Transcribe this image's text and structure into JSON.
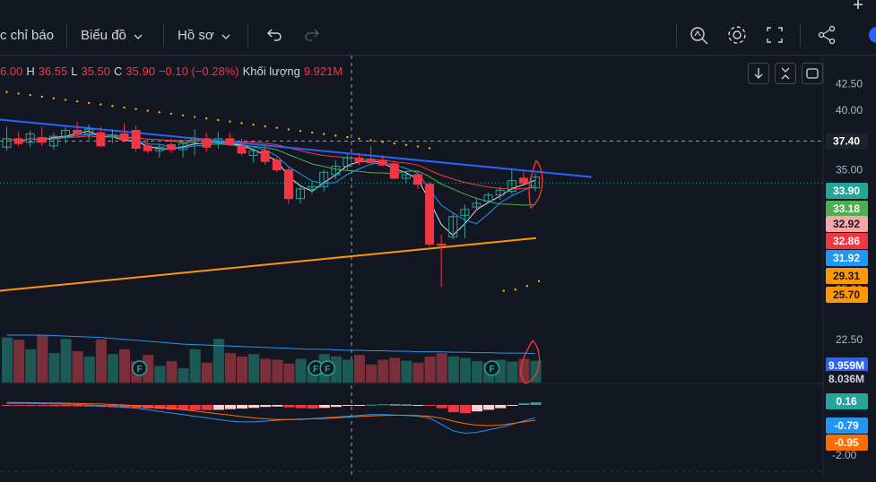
{
  "toolbar": {
    "indicators_label": "c chỉ báo",
    "chart_type_label": "Biểu đồ",
    "profile_label": "Hồ sơ",
    "icons": [
      "undo-icon",
      "redo-icon",
      "search-chart-icon",
      "gear-icon",
      "fullscreen-icon",
      "share-icon"
    ]
  },
  "legend": {
    "open": "6.00",
    "high_label": "H",
    "high": "36.55",
    "low_label": "L",
    "low": "35.50",
    "close_label": "C",
    "close": "35.90",
    "change": "−0.10 (−0.28%)",
    "volume_label": "Khối lượng",
    "volume": "9.921M"
  },
  "chart_data": {
    "type": "candlestick",
    "price_axis": {
      "ticks": [
        "42.50",
        "40.00",
        "35.00",
        "22.50",
        "25.00"
      ],
      "range": [
        21.5,
        43.5
      ]
    },
    "price_tags": [
      {
        "label": "37.40",
        "color": "#1e222d",
        "text_color": "#ffffff"
      },
      {
        "label": "33.90",
        "color": "#26a69a",
        "text_color": "#ffffff"
      },
      {
        "label": "33.18",
        "color": "#4caf50",
        "text_color": "#ffffff"
      },
      {
        "label": "32.92",
        "color": "#f7a6a6",
        "text_color": "#131722"
      },
      {
        "label": "32.86",
        "color": "#f23645",
        "text_color": "#ffffff"
      },
      {
        "label": "31.92",
        "color": "#2196f3",
        "text_color": "#ffffff"
      },
      {
        "label": "29.31",
        "color": "#ff9800",
        "text_color": "#131722"
      },
      {
        "label": "25.70",
        "color": "#ff9800",
        "text_color": "#131722"
      }
    ],
    "volume_tags": [
      {
        "label": "9.959M",
        "color": "#2962ff",
        "text_color": "#ffffff"
      },
      {
        "label": "8.036M",
        "color": "#131722",
        "text_color": "#d1d4dc"
      }
    ],
    "macd_axis": {
      "ticks": [
        "-2.00"
      ]
    },
    "macd_tags": [
      {
        "label": "0.16",
        "color": "#26a69a",
        "text_color": "#ffffff"
      },
      {
        "label": "-0.79",
        "color": "#2196f3",
        "text_color": "#ffffff"
      },
      {
        "label": "-0.95",
        "color": "#ff6d00",
        "text_color": "#ffffff"
      }
    ],
    "candles": [
      {
        "o": 36.9,
        "h": 38.6,
        "l": 36.6,
        "c": 37.6
      },
      {
        "o": 37.6,
        "h": 38.2,
        "l": 37.0,
        "c": 37.2
      },
      {
        "o": 37.3,
        "h": 38.3,
        "l": 36.9,
        "c": 38.0
      },
      {
        "o": 37.7,
        "h": 38.6,
        "l": 37.0,
        "c": 37.3
      },
      {
        "o": 37.0,
        "h": 38.1,
        "l": 36.7,
        "c": 37.8
      },
      {
        "o": 37.8,
        "h": 38.6,
        "l": 37.2,
        "c": 38.3
      },
      {
        "o": 38.3,
        "h": 39.0,
        "l": 37.8,
        "c": 38.0
      },
      {
        "o": 38.0,
        "h": 38.8,
        "l": 37.5,
        "c": 38.4
      },
      {
        "o": 38.1,
        "h": 38.6,
        "l": 36.9,
        "c": 37.0
      },
      {
        "o": 37.8,
        "h": 38.4,
        "l": 37.2,
        "c": 37.9
      },
      {
        "o": 38.0,
        "h": 38.9,
        "l": 37.3,
        "c": 37.5
      },
      {
        "o": 38.3,
        "h": 38.7,
        "l": 36.5,
        "c": 36.8
      },
      {
        "o": 37.0,
        "h": 37.6,
        "l": 36.4,
        "c": 36.6
      },
      {
        "o": 36.6,
        "h": 37.2,
        "l": 36.0,
        "c": 36.9
      },
      {
        "o": 37.1,
        "h": 37.6,
        "l": 36.4,
        "c": 36.7
      },
      {
        "o": 36.7,
        "h": 37.4,
        "l": 36.0,
        "c": 37.2
      },
      {
        "o": 37.4,
        "h": 38.4,
        "l": 36.2,
        "c": 37.6
      },
      {
        "o": 37.6,
        "h": 38.1,
        "l": 36.5,
        "c": 36.9
      },
      {
        "o": 37.3,
        "h": 38.2,
        "l": 36.8,
        "c": 37.6
      },
      {
        "o": 37.6,
        "h": 38.1,
        "l": 37.0,
        "c": 37.1
      },
      {
        "o": 37.0,
        "h": 37.6,
        "l": 36.2,
        "c": 36.4
      },
      {
        "o": 36.2,
        "h": 36.8,
        "l": 35.6,
        "c": 36.6
      },
      {
        "o": 36.6,
        "h": 37.1,
        "l": 35.4,
        "c": 35.7
      },
      {
        "o": 35.8,
        "h": 36.0,
        "l": 34.8,
        "c": 35.0
      },
      {
        "o": 35.0,
        "h": 35.2,
        "l": 32.1,
        "c": 32.6
      },
      {
        "o": 32.6,
        "h": 33.6,
        "l": 32.2,
        "c": 33.4
      },
      {
        "o": 33.4,
        "h": 34.0,
        "l": 33.0,
        "c": 33.6
      },
      {
        "o": 33.6,
        "h": 35.0,
        "l": 33.2,
        "c": 34.8
      },
      {
        "o": 34.6,
        "h": 35.8,
        "l": 34.2,
        "c": 35.3
      },
      {
        "o": 35.3,
        "h": 36.3,
        "l": 35.0,
        "c": 36.0
      },
      {
        "o": 36.0,
        "h": 36.4,
        "l": 35.4,
        "c": 35.7
      },
      {
        "o": 35.9,
        "h": 37.0,
        "l": 35.5,
        "c": 35.6
      },
      {
        "o": 35.8,
        "h": 36.2,
        "l": 35.3,
        "c": 35.4
      },
      {
        "o": 35.5,
        "h": 35.8,
        "l": 34.2,
        "c": 34.3
      },
      {
        "o": 34.3,
        "h": 34.8,
        "l": 33.9,
        "c": 34.6
      },
      {
        "o": 34.6,
        "h": 34.9,
        "l": 33.4,
        "c": 33.8
      },
      {
        "o": 33.8,
        "h": 34.0,
        "l": 28.6,
        "c": 28.8
      },
      {
        "o": 28.8,
        "h": 29.6,
        "l": 25.2,
        "c": 28.7
      },
      {
        "o": 29.4,
        "h": 31.4,
        "l": 29.2,
        "c": 31.1
      },
      {
        "o": 31.2,
        "h": 32.1,
        "l": 29.3,
        "c": 31.7
      },
      {
        "o": 31.9,
        "h": 32.6,
        "l": 31.7,
        "c": 32.2
      },
      {
        "o": 32.4,
        "h": 33.1,
        "l": 32.3,
        "c": 32.9
      },
      {
        "o": 32.9,
        "h": 33.6,
        "l": 32.5,
        "c": 33.3
      },
      {
        "o": 33.2,
        "h": 35.1,
        "l": 33.0,
        "c": 34.1
      },
      {
        "o": 34.3,
        "h": 35.0,
        "l": 33.8,
        "c": 33.9
      },
      {
        "o": 33.5,
        "h": 34.7,
        "l": 33.2,
        "c": 34.4
      }
    ],
    "volumes": [
      0.95,
      0.9,
      0.7,
      1.0,
      0.62,
      0.92,
      0.66,
      0.55,
      0.91,
      0.6,
      0.7,
      0.45,
      0.58,
      0.35,
      0.45,
      0.3,
      0.7,
      0.42,
      0.92,
      0.62,
      0.55,
      0.6,
      0.5,
      0.48,
      0.4,
      0.5,
      0.35,
      0.6,
      0.55,
      0.48,
      0.58,
      0.38,
      0.48,
      0.52,
      0.46,
      0.42,
      0.55,
      0.62,
      0.55,
      0.52,
      0.45,
      0.42,
      0.48,
      0.44,
      0.5,
      0.46
    ],
    "volume_ma": [
      1.0,
      1.0,
      1.0,
      1.0,
      0.99,
      0.98,
      0.97,
      0.96,
      0.95,
      0.93,
      0.91,
      0.89,
      0.87,
      0.85,
      0.83,
      0.81,
      0.8,
      0.79,
      0.78,
      0.77,
      0.76,
      0.75,
      0.74,
      0.73,
      0.72,
      0.71,
      0.7,
      0.7,
      0.69,
      0.68,
      0.68,
      0.67,
      0.67,
      0.66,
      0.66,
      0.65,
      0.65,
      0.65,
      0.64,
      0.64,
      0.63,
      0.63,
      0.62,
      0.62,
      0.62,
      0.61
    ],
    "macd_hist": [
      -0.05,
      -0.06,
      -0.06,
      -0.07,
      -0.08,
      -0.08,
      -0.09,
      -0.1,
      -0.12,
      -0.14,
      -0.16,
      -0.18,
      -0.22,
      -0.25,
      -0.28,
      -0.3,
      -0.32,
      -0.32,
      -0.3,
      -0.26,
      -0.22,
      -0.18,
      -0.12,
      -0.1,
      -0.15,
      -0.2,
      -0.22,
      -0.18,
      -0.12,
      -0.05,
      -0.02,
      0.02,
      0.04,
      0.03,
      0.02,
      0.0,
      -0.04,
      -0.2,
      -0.45,
      -0.5,
      -0.4,
      -0.3,
      -0.2,
      -0.05,
      0.1,
      0.16
    ],
    "macd_line": [
      0.1,
      0.1,
      0.1,
      0.08,
      0.06,
      0.05,
      0.03,
      0.0,
      -0.05,
      -0.1,
      -0.15,
      -0.2,
      -0.3,
      -0.4,
      -0.5,
      -0.6,
      -0.7,
      -0.8,
      -0.9,
      -1.0,
      -1.05,
      -1.05,
      -1.0,
      -0.95,
      -0.9,
      -0.9,
      -0.85,
      -0.8,
      -0.75,
      -0.7,
      -0.65,
      -0.6,
      -0.6,
      -0.62,
      -0.65,
      -0.7,
      -0.8,
      -1.2,
      -1.6,
      -1.75,
      -1.7,
      -1.55,
      -1.4,
      -1.2,
      -1.0,
      -0.79
    ],
    "signal_line": [
      0.15,
      0.15,
      0.14,
      0.13,
      0.12,
      0.11,
      0.1,
      0.08,
      0.06,
      0.03,
      0.0,
      -0.04,
      -0.1,
      -0.16,
      -0.22,
      -0.3,
      -0.38,
      -0.46,
      -0.55,
      -0.63,
      -0.72,
      -0.8,
      -0.86,
      -0.9,
      -0.9,
      -0.88,
      -0.86,
      -0.84,
      -0.8,
      -0.76,
      -0.72,
      -0.68,
      -0.65,
      -0.64,
      -0.64,
      -0.66,
      -0.7,
      -0.82,
      -1.0,
      -1.15,
      -1.25,
      -1.28,
      -1.25,
      -1.15,
      -1.05,
      -0.95
    ]
  }
}
